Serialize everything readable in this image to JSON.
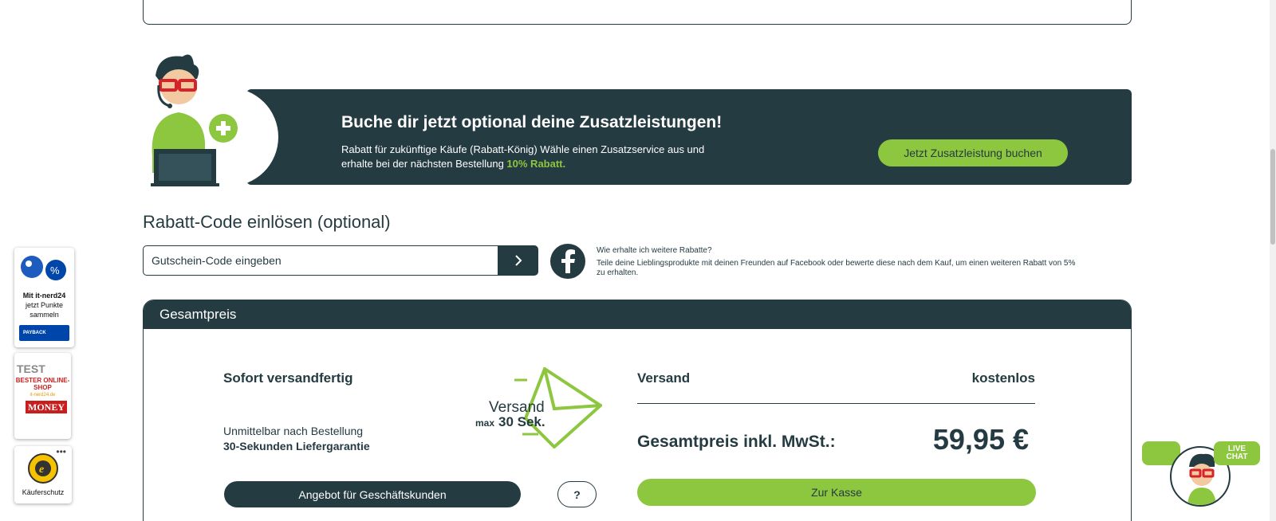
{
  "promo": {
    "title": "Buche dir jetzt optional deine Zusatzleistungen!",
    "text": "Rabatt für zukünftige Käufe (Rabatt-König) Wähle einen Zusatzservice aus und erhalte bei der nächsten Bestellung ",
    "highlight": "10% Rabatt.",
    "button": "Jetzt Zusatzleistung buchen"
  },
  "rabatt": {
    "title": "Rabatt-Code einlösen (optional)",
    "placeholder": "Gutschein-Code eingeben",
    "fb_question": "Wie erhalte ich weitere Rabatte?",
    "fb_text": "Teile deine Lieblingsprodukte mit deinen Freunden auf Facebook oder bewerte diese nach dem Kauf, um einen weiteren Rabatt von 5% zu erhalten."
  },
  "total": {
    "header": "Gesamtpreis",
    "shipping_ready_title": "Sofort versandfertig",
    "shipping_ready_line1": "Unmittelbar nach Bestellung",
    "shipping_ready_line2": "30-Sekunden Liefergarantie",
    "envelope_text": "Versand",
    "envelope_subtext_max": "max",
    "envelope_subtext": "30 Sek.",
    "business_button": "Angebot für Geschäftskunden",
    "help_button": "?",
    "shipping_label": "Versand",
    "shipping_value": "kostenlos",
    "sum_label": "Gesamtpreis inkl. MwSt.:",
    "sum_value": "59,95 €",
    "checkout_button": "Zur Kasse"
  },
  "badges": {
    "payback_text_bold": "Mit it-nerd24",
    "payback_text": "jetzt Punkte sammeln",
    "payback_logo": "PAYBACK",
    "test_label": "TEST",
    "test_best": "BESTER ONLINE-SHOP",
    "test_site": "it-nerd24.de",
    "test_money": "MONEY",
    "trust_label": "Käuferschutz"
  },
  "livechat": {
    "label_line1": "LIVE",
    "label_line2": "CHAT"
  },
  "colors": {
    "primary": "#243b42",
    "accent": "#8dc63f"
  }
}
